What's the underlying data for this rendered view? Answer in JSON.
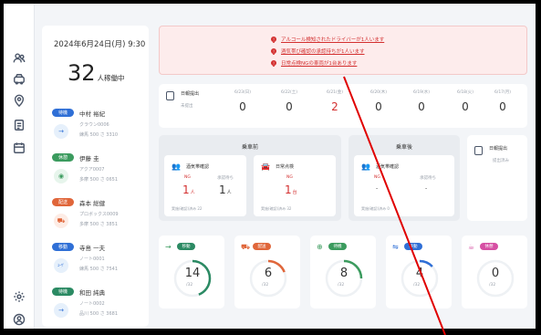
{
  "header": {
    "date": "2024年6月24日(月) 9:30",
    "working_count": "32",
    "working_unit": "人稼働中"
  },
  "colors": {
    "working": "#2b8a63",
    "delivery": "#e0663a",
    "moving": "#2f6fd6",
    "alert_red": "#d32f2f",
    "purple": "#d64fa3",
    "green": "#3b9b5e"
  },
  "drivers": [
    {
      "status": "待機",
      "name": "中村 裕紀",
      "vehicle": "クラウン0006",
      "plate": "練馬 500 さ 3310",
      "icon": "→"
    },
    {
      "status": "休憩",
      "name": "伊藤 圭",
      "vehicle": "アクア0007",
      "plate": "多摩 500 さ 0651",
      "icon": "◉"
    },
    {
      "status": "配送",
      "name": "森本 総健",
      "vehicle": "プロボックス0009",
      "plate": "多摩 500 さ 3851",
      "icon": "⛟"
    },
    {
      "status": "移動",
      "name": "寺島 一夫",
      "vehicle": "ノート0001",
      "plate": "練馬 500 さ 7541",
      "icon": "ﾕｰｻﾞ"
    },
    {
      "status": "待機",
      "name": "和田 純典",
      "vehicle": "ノート0002",
      "plate": "品川 500 さ 3681",
      "icon": "→"
    }
  ],
  "alerts": [
    "アルコール検知されたドライバーが1人います",
    "酒気帯び確認の承認待ちが1人います",
    "日常点検NGの車両が1台あります"
  ],
  "daily_report": {
    "title": "日報提出",
    "sub": "未提出",
    "dates": [
      "6/23(日)",
      "6/22(土)",
      "6/21(金)",
      "6/20(木)",
      "6/19(水)",
      "6/18(火)",
      "6/17(月)"
    ],
    "values": [
      "0",
      "0",
      "2",
      "0",
      "0",
      "0",
      "0"
    ]
  },
  "before_ride": {
    "title": "乗車前",
    "alcohol_card": {
      "title": "酒気帯確認",
      "ng_label": "NG",
      "ng_value": "1",
      "ng_unit": "人",
      "pending_label": "承認待ち",
      "pending_value": "1",
      "pending_unit": "人",
      "footer": "実施(確認)済み 22"
    },
    "inspection_card": {
      "title": "日常点検",
      "ng_label": "NG",
      "ng_value": "1",
      "ng_unit": "台",
      "footer": "実施(確認)済み 32"
    }
  },
  "after_ride": {
    "title": "乗車後",
    "alcohol_card": {
      "title": "酒気帯確認",
      "ng_label": "NG",
      "ng_value": "-",
      "pending_label": "承認待ち",
      "pending_value": "-",
      "footer": "実施(確認)済み 0"
    }
  },
  "side_report": {
    "title": "日報提出",
    "sub": "提出済み"
  },
  "stats": [
    {
      "label": "移動",
      "value": "14",
      "total": "/32",
      "color": "#2b8a63",
      "fraction": 0.44,
      "icon": "→"
    },
    {
      "label": "配送",
      "value": "6",
      "total": "/32",
      "color": "#e0663a",
      "fraction": 0.19,
      "icon": "⛟"
    },
    {
      "label": "待機",
      "value": "8",
      "total": "/32",
      "color": "#3b9b5e",
      "fraction": 0.25,
      "icon": "⊕"
    },
    {
      "label": "移動",
      "value": "4",
      "total": "/32",
      "color": "#2f6fd6",
      "fraction": 0.13,
      "icon": "⇋"
    },
    {
      "label": "休憩",
      "value": "0",
      "total": "/32",
      "color": "#d64fa3",
      "fraction": 0.0,
      "icon": "☕"
    }
  ]
}
